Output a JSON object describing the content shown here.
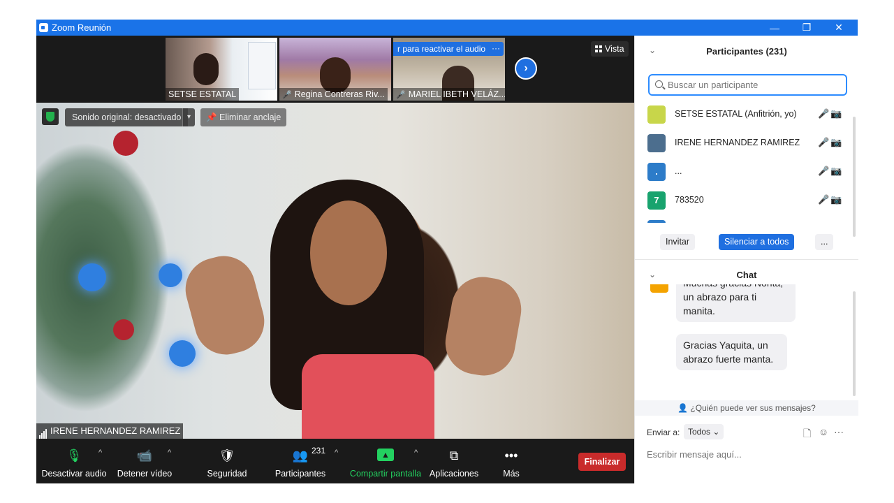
{
  "window": {
    "title": "Zoom Reunión",
    "minimize": "—",
    "restore": "❐",
    "close": "✕"
  },
  "gallery": {
    "thumbs": [
      {
        "name": "SETSE ESTATAL",
        "muted": false
      },
      {
        "name": "Regina Contreras Riv...",
        "muted": true
      },
      {
        "name": "MARIEL IBETH VELÁZ...",
        "muted": true
      }
    ],
    "reactivar_label": "r para reactivar el audio",
    "reactivar_more": "···",
    "next": "›",
    "view_label": "Vista"
  },
  "video": {
    "sound_label": "Sonido original: desactivado",
    "sound_caret": "▾",
    "unpin_label": "Eliminar anclaje",
    "speaker_name": "IRENE HERNANDEZ RAMIREZ"
  },
  "toolbar": {
    "audio_label": "Desactivar audio",
    "video_label": "Detener vídeo",
    "security_label": "Seguridad",
    "participants_label": "Participantes",
    "participants_count": "231",
    "share_label": "Compartir pantalla",
    "apps_label": "Aplicaciones",
    "more_label": "Más",
    "end_label": "Finalizar",
    "caret": "^"
  },
  "participants": {
    "title": "Participantes (231)",
    "search_placeholder": "Buscar un participante",
    "list": [
      {
        "name": "SETSE ESTATAL (Anfitrión, yo)",
        "avatar_text": "",
        "avatar_color": "#c8d64a",
        "muted": false
      },
      {
        "name": "IRENE HERNANDEZ RAMIREZ",
        "avatar_text": "",
        "avatar_color": "#4c6e8e",
        "muted": false
      },
      {
        "name": "...",
        "avatar_text": ".",
        "avatar_color": "#2d7cc9",
        "muted": true
      },
      {
        "name": "783520",
        "avatar_text": "7",
        "avatar_color": "#18a36e",
        "muted": true
      }
    ],
    "invite_label": "Invitar",
    "mute_all_label": "Silenciar a todos",
    "more_label": "..."
  },
  "chat": {
    "title": "Chat",
    "messages": [
      {
        "text": "Muchas gracias Norita, un abrazo para ti manita."
      },
      {
        "text": "Gracias Yaquita, un abrazo fuerte manta."
      }
    ],
    "who_can_see": "¿Quién puede ver sus mensajes?",
    "send_to_label": "Enviar a:",
    "send_to_value": "Todos",
    "compose_placeholder": "Escribir mensaje aquí..."
  },
  "colors": {
    "accent": "#1f6fe0",
    "end": "#c92b2b",
    "share": "#23d160",
    "muted": "#e02f2f"
  }
}
